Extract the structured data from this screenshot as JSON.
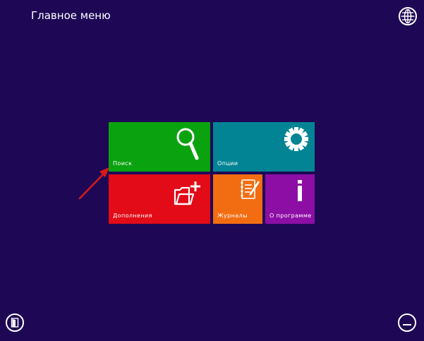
{
  "header": {
    "title": "Главное меню"
  },
  "icons": {
    "globe": "globe-icon",
    "exit": "exit-door-icon",
    "minimize": "minimize-icon",
    "search": "magnifier-icon",
    "options": "gear-icon",
    "addons": "folder-plus-icon",
    "journals": "notebook-pencil-icon",
    "about": "info-icon"
  },
  "tiles": [
    {
      "label": "Поиск",
      "color": "#0ba20f"
    },
    {
      "label": "Опции",
      "color": "#028495"
    },
    {
      "label": "Дополнения",
      "color": "#e20b17"
    },
    {
      "label": "Журналы",
      "color": "#f26d11"
    },
    {
      "label": "О программе",
      "color": "#8d0ea5"
    }
  ],
  "colors": {
    "background": "#1e0855",
    "annotation_arrow": "#e01818"
  }
}
